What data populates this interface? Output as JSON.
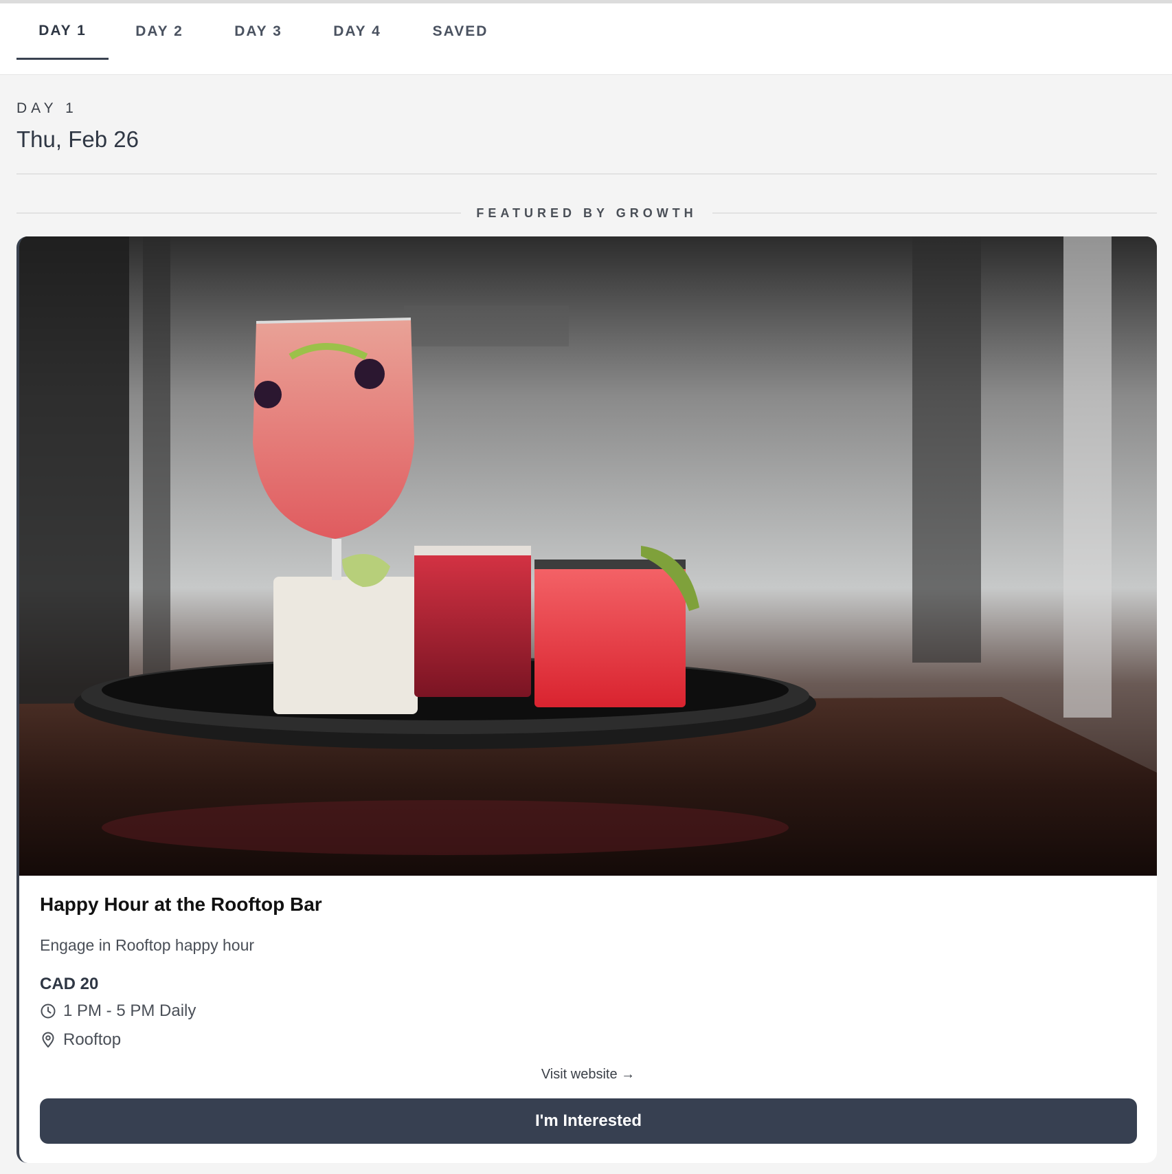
{
  "tabs": [
    {
      "label": "DAY 1",
      "active": true
    },
    {
      "label": "DAY 2",
      "active": false
    },
    {
      "label": "DAY 3",
      "active": false
    },
    {
      "label": "DAY 4",
      "active": false
    },
    {
      "label": "SAVED",
      "active": false
    }
  ],
  "day": {
    "kicker": "DAY 1",
    "date": "Thu, Feb 26"
  },
  "featured": {
    "label": "FEATURED BY GROWTH"
  },
  "event": {
    "image_alt": "cocktails-on-tray-photo",
    "title": "Happy Hour at the Rooftop Bar",
    "description": "Engage in Rooftop happy hour",
    "price": "CAD 20",
    "time": "1 PM - 5 PM Daily",
    "time_icon": "clock-icon",
    "location": "Rooftop",
    "location_icon": "map-pin-icon",
    "visit_link": "Visit website →",
    "cta": "I'm Interested"
  },
  "colors": {
    "accent": "#374051",
    "page_bg": "#f4f4f4",
    "card_bg": "#ffffff"
  }
}
